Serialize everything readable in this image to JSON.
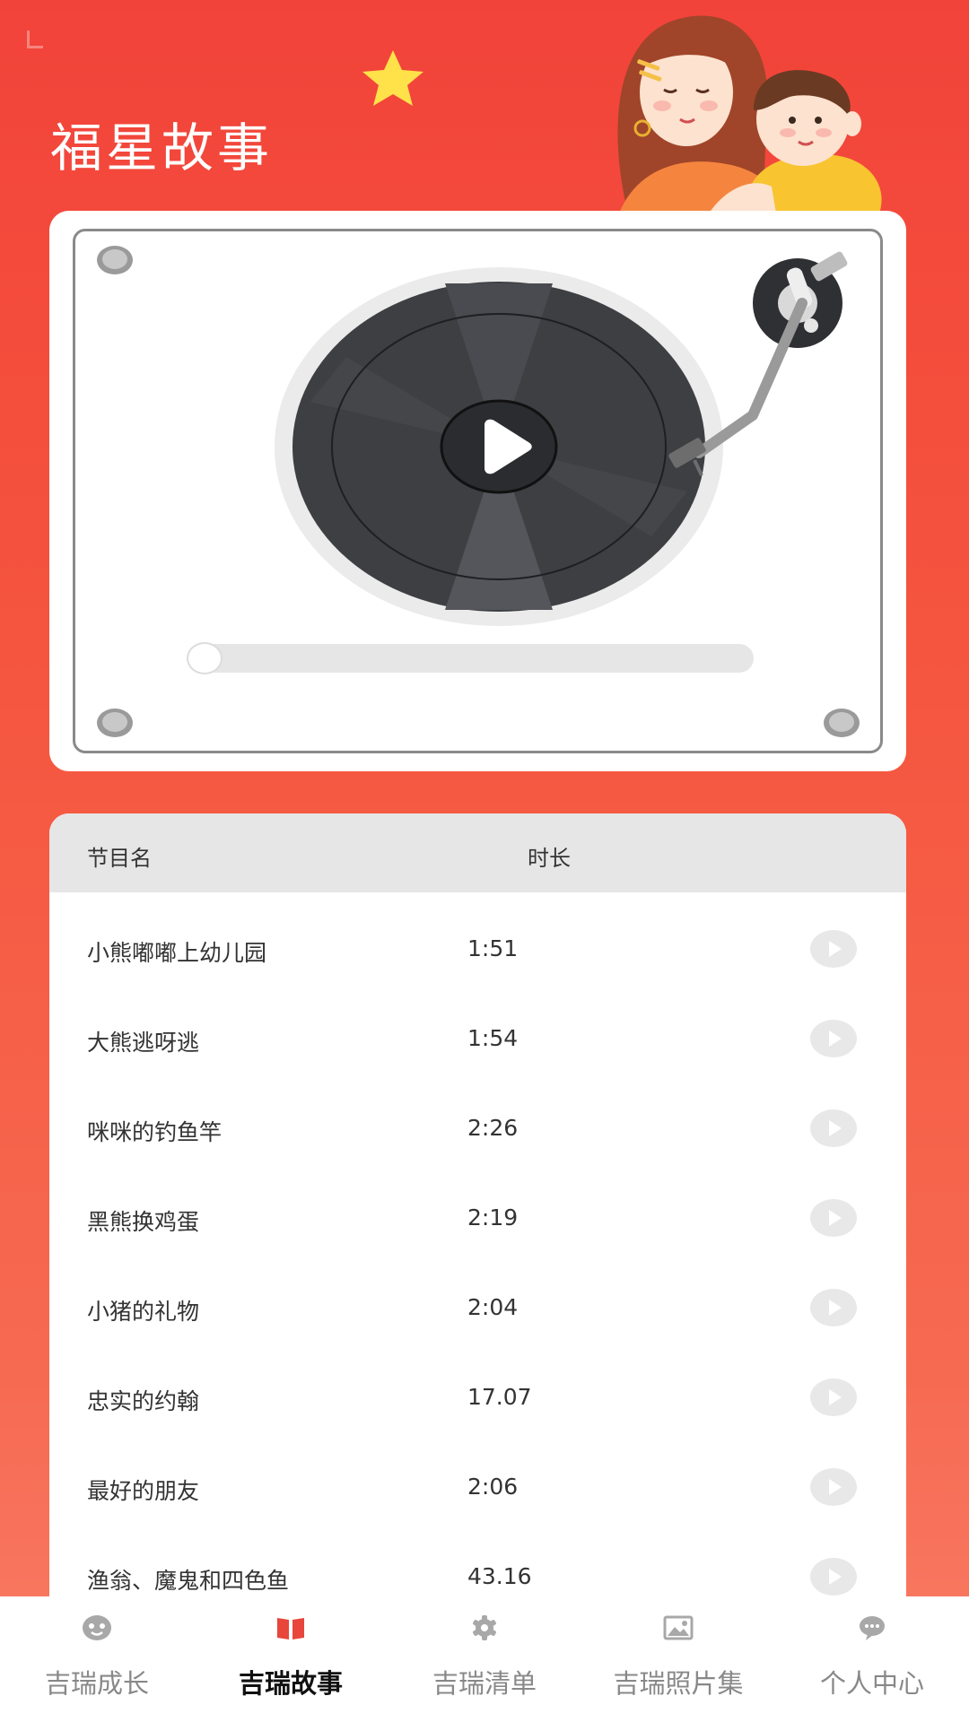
{
  "header": {
    "title": "福星故事"
  },
  "player": {
    "progress": 0
  },
  "list": {
    "col_name": "节目名",
    "col_duration": "时长",
    "items": [
      {
        "name": "小熊嘟嘟上幼儿园",
        "duration": "1:51"
      },
      {
        "name": "大熊逃呀逃",
        "duration": "1:54"
      },
      {
        "name": "咪咪的钓鱼竿",
        "duration": "2:26"
      },
      {
        "name": "黑熊换鸡蛋",
        "duration": "2:19"
      },
      {
        "name": "小猪的礼物",
        "duration": "2:04"
      },
      {
        "name": "忠实的约翰",
        "duration": "17.07"
      },
      {
        "name": "最好的朋友",
        "duration": "2:06"
      },
      {
        "name": "渔翁、魔鬼和四色鱼",
        "duration": "43.16"
      }
    ]
  },
  "nav": {
    "items": [
      {
        "label": "吉瑞成长",
        "icon": "face-icon"
      },
      {
        "label": "吉瑞故事",
        "icon": "book-icon"
      },
      {
        "label": "吉瑞清单",
        "icon": "gear-icon"
      },
      {
        "label": "吉瑞照片集",
        "icon": "image-icon"
      },
      {
        "label": "个人中心",
        "icon": "chat-bubble-icon"
      }
    ],
    "active_index": 1
  },
  "colors": {
    "brand": "#f2433a",
    "active_icon": "#e8453b"
  }
}
